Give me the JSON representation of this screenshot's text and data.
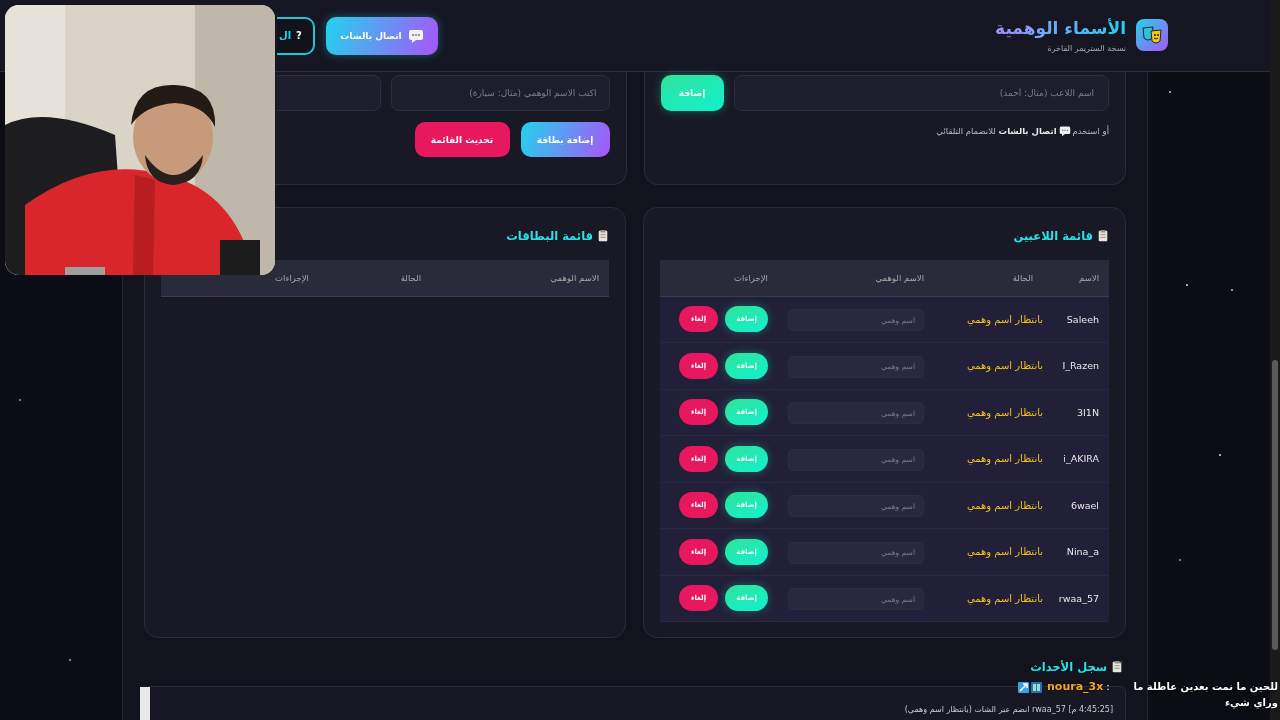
{
  "header": {
    "title": "الأسماء الوهمية",
    "subtitle": "نسخة الستريمر الفاخرة",
    "buttons": [
      {
        "kind": "chat",
        "label": "اتصال بالشات"
      },
      {
        "kind": "help",
        "symbol": "?",
        "label": "ال"
      }
    ]
  },
  "player_form": {
    "input": {
      "placeholder": "اسم اللاعب (مثال: أحمد)"
    },
    "add_button": "إضافة",
    "hint_before": "أو استخدم",
    "hint_after": "**اتصال بالشات** للانضمام التلقائي"
  },
  "card_form": {
    "input": {
      "placeholder": "اكتب الاسم الوهمي (مثال: سيارة)"
    },
    "buttons": [
      {
        "kind": "primary",
        "label": "إضافة بطاقة"
      },
      {
        "kind": "danger",
        "label": "تحديث القائمة"
      }
    ]
  },
  "players": {
    "title": "قائمة اللاعبين",
    "columns": [
      "الاسم",
      "الحالة",
      "الاسم الوهمي",
      "الإجراءات"
    ],
    "rows": [
      {
        "name": "Saleeh",
        "status": "بانتظار اسم وهمي",
        "fake_name": {
          "placeholder": "اسم وهمي"
        },
        "add": "إضافة",
        "cancel": "إلغاء"
      },
      {
        "name": "I_Razen",
        "status": "بانتظار اسم وهمي",
        "fake_name": {
          "placeholder": "اسم وهمي"
        },
        "add": "إضافة",
        "cancel": "إلغاء"
      },
      {
        "name": "3I1N",
        "status": "بانتظار اسم وهمي",
        "fake_name": {
          "placeholder": "اسم وهمي"
        },
        "add": "إضافة",
        "cancel": "إلغاء"
      },
      {
        "name": "i_AKIRA",
        "status": "بانتظار اسم وهمي",
        "fake_name": {
          "placeholder": "اسم وهمي"
        },
        "add": "إضافة",
        "cancel": "إلغاء"
      },
      {
        "name": "6wael",
        "status": "بانتظار اسم وهمي",
        "fake_name": {
          "placeholder": "اسم وهمي"
        },
        "add": "إضافة",
        "cancel": "إلغاء"
      },
      {
        "name": "Nina_a",
        "status": "بانتظار اسم وهمي",
        "fake_name": {
          "placeholder": "اسم وهمي"
        },
        "add": "إضافة",
        "cancel": "إلغاء"
      },
      {
        "name": "rwaa_57",
        "status": "بانتظار اسم وهمي",
        "fake_name": {
          "placeholder": "اسم وهمي"
        },
        "add": "إضافة",
        "cancel": "إلغاء"
      }
    ]
  },
  "cards": {
    "title": "قائمة البطاقات",
    "columns": [
      "الاسم الوهمي",
      "الحالة",
      "الإجراءات"
    ]
  },
  "log": {
    "title": "سجل الأحداث",
    "entries": [
      "[4:45:25 م] rwaa_57 انضم عبر الشات (بانتظار اسم وهمي)"
    ]
  },
  "chat_overlay": {
    "user": "noura_3x",
    "separator": ":",
    "message": "للحين ما نمت بعدين عاطلة ما وراي شيء"
  }
}
